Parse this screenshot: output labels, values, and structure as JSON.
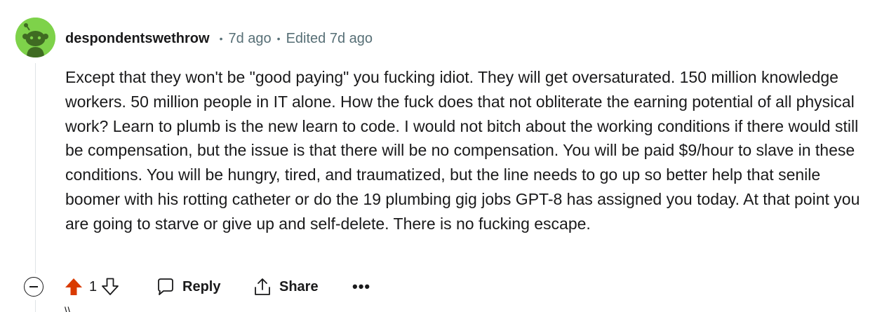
{
  "comment": {
    "author": "despondentswethrow",
    "posted": "7d ago",
    "edited": "Edited 7d ago",
    "separator": "•",
    "body": "Except that they won't be \"good paying\" you fucking idiot. They will get oversaturated. 150 million knowledge workers. 50 million people in IT alone. How the fuck does that not obliterate the earning potential of all physical work? Learn to plumb is the new learn to code. I would not bitch about the working conditions if there would still be compensation, but the issue is that there will be no compensation. You will be paid $9/hour to slave in these conditions. You will be hungry, tired, and traumatized, but the line needs to go up so better help that senile boomer with his rotting catheter or do the 19 plumbing gig jobs GPT-8 has assigned you today. At that point you are going to starve or give up and self-delete. There is no fucking escape.",
    "avatar_icon": "snoo-avatar-icon",
    "avatar_color": "#7ed24a"
  },
  "actions": {
    "upvote_icon": "upvote-icon",
    "upvote_color": "#d93a00",
    "score": "1",
    "downvote_icon": "downvote-icon",
    "reply_label": "Reply",
    "reply_icon": "comment-icon",
    "share_label": "Share",
    "share_icon": "share-icon",
    "more_label": "•••",
    "collapse_icon": "collapse-minus-icon"
  },
  "next_comment_hint": "\\\\"
}
